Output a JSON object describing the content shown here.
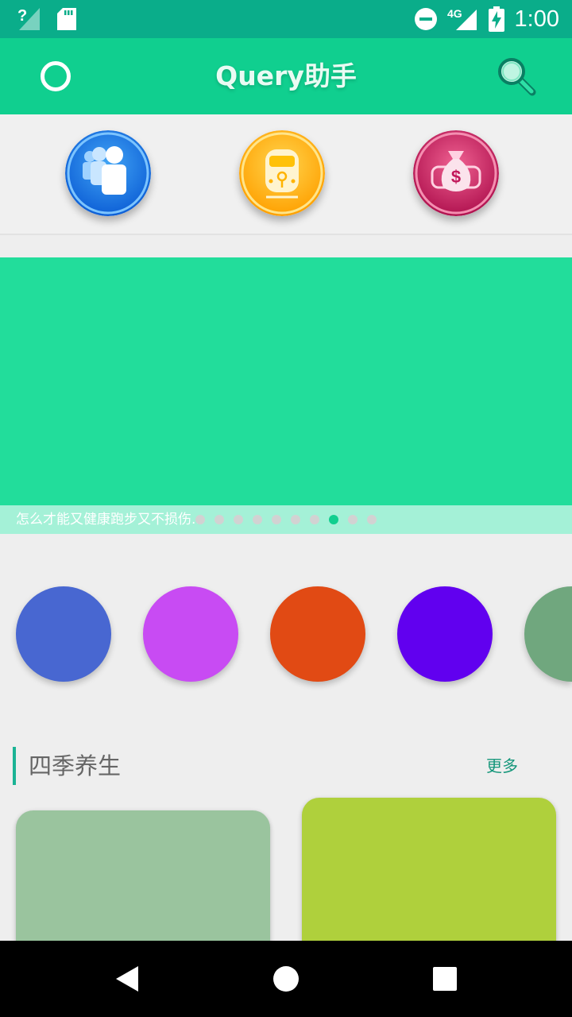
{
  "status_bar": {
    "time": "1:00",
    "network_label": "4G",
    "icons": [
      "signal-unknown-icon",
      "sd-card-icon",
      "do-not-disturb-icon",
      "mobile-signal-icon",
      "battery-charging-icon"
    ]
  },
  "app_bar": {
    "title": "Query助手",
    "left_icon": "ring-icon",
    "right_icon": "search-icon"
  },
  "quick_actions": [
    {
      "name": "people",
      "icon": "people-icon",
      "color": "#1e88e5"
    },
    {
      "name": "train",
      "icon": "train-icon",
      "color": "#ffb300"
    },
    {
      "name": "money",
      "icon": "money-bag-icon",
      "color": "#d81b60"
    }
  ],
  "banner": {
    "caption": "怎么才能又健康跑步又不损伤...",
    "page_count": 10,
    "active_page": 8,
    "color": "#22dd9b"
  },
  "category_circles": [
    {
      "color": "#4867d1"
    },
    {
      "color": "#c84bf3"
    },
    {
      "color": "#e14a14"
    },
    {
      "color": "#6100ef"
    },
    {
      "color": "#70a77e"
    }
  ],
  "section": {
    "title": "四季养生",
    "more_label": "更多",
    "cards": [
      {
        "color": "#9ac49e"
      },
      {
        "color": "#afd03c"
      }
    ]
  },
  "nav_bar": {
    "icons": [
      "back-icon",
      "home-icon",
      "recents-icon"
    ]
  }
}
